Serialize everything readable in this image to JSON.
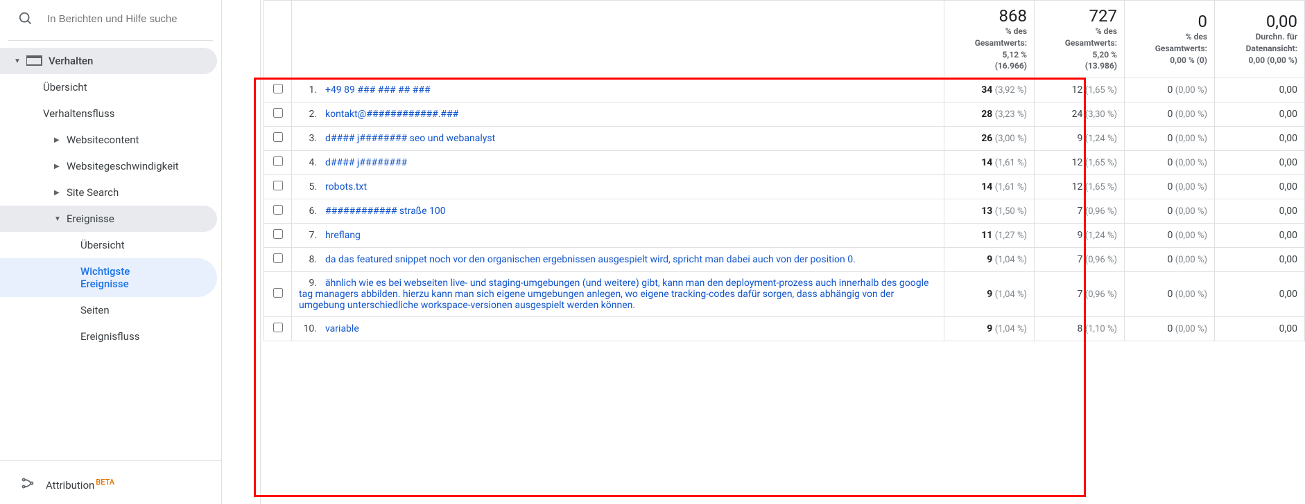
{
  "sidebar": {
    "search_placeholder": "In Berichten und Hilfe suche",
    "section": "Verhalten",
    "items": {
      "uebersicht": "Übersicht",
      "verhaltensfluss": "Verhaltensfluss",
      "websitecontent": "Websitecontent",
      "websitegeschw": "Websitegeschwindigkeit",
      "sitesearch": "Site Search",
      "ereignisse": "Ereignisse",
      "er_uebersicht": "Übersicht",
      "er_wichtigste": "Wichtigste Ereignisse",
      "er_seiten": "Seiten",
      "er_fluss": "Ereignisfluss"
    },
    "attribution": "Attribution",
    "beta": "BETA"
  },
  "table": {
    "header": {
      "col1": {
        "big": "868",
        "sub1": "% des Gesamtwerts:",
        "sub2": "5,12 %",
        "sub3": "(16.966)"
      },
      "col2": {
        "big": "727",
        "sub1": "% des Gesamtwerts:",
        "sub2": "5,20 %",
        "sub3": "(13.986)"
      },
      "col3": {
        "big": "0",
        "sub1": "% des Gesamtwerts:",
        "sub2": "0,00 % (0)"
      },
      "col4": {
        "big": "0,00",
        "sub1": "Durchn. für Datenansicht:",
        "sub2": "0,00 (0,00 %)"
      }
    },
    "rows": [
      {
        "n": "1.",
        "label": "+49 89 ### ### ## ###",
        "v1b": "34",
        "v1p": "(3,92 %)",
        "v2": "12",
        "v2p": "(1,65 %)",
        "v3": "0",
        "v3p": "(0,00 %)",
        "v4": "0,00"
      },
      {
        "n": "2.",
        "label": "kontakt@############.###",
        "v1b": "28",
        "v1p": "(3,23 %)",
        "v2": "24",
        "v2p": "(3,30 %)",
        "v3": "0",
        "v3p": "(0,00 %)",
        "v4": "0,00"
      },
      {
        "n": "3.",
        "label": "d#### j######## seo und webanalyst",
        "v1b": "26",
        "v1p": "(3,00 %)",
        "v2": "9",
        "v2p": "(1,24 %)",
        "v3": "0",
        "v3p": "(0,00 %)",
        "v4": "0,00"
      },
      {
        "n": "4.",
        "label": "d#### j########",
        "v1b": "14",
        "v1p": "(1,61 %)",
        "v2": "12",
        "v2p": "(1,65 %)",
        "v3": "0",
        "v3p": "(0,00 %)",
        "v4": "0,00"
      },
      {
        "n": "5.",
        "label": "robots.txt",
        "v1b": "14",
        "v1p": "(1,61 %)",
        "v2": "12",
        "v2p": "(1,65 %)",
        "v3": "0",
        "v3p": "(0,00 %)",
        "v4": "0,00"
      },
      {
        "n": "6.",
        "label": "############ straße 100",
        "v1b": "13",
        "v1p": "(1,50 %)",
        "v2": "7",
        "v2p": "(0,96 %)",
        "v3": "0",
        "v3p": "(0,00 %)",
        "v4": "0,00"
      },
      {
        "n": "7.",
        "label": "hreflang",
        "v1b": "11",
        "v1p": "(1,27 %)",
        "v2": "9",
        "v2p": "(1,24 %)",
        "v3": "0",
        "v3p": "(0,00 %)",
        "v4": "0,00"
      },
      {
        "n": "8.",
        "label": "da das featured snippet noch vor den organischen ergebnissen ausgespielt wird, spricht man dabei auch von der position 0.",
        "v1b": "9",
        "v1p": "(1,04 %)",
        "v2": "7",
        "v2p": "(0,96 %)",
        "v3": "0",
        "v3p": "(0,00 %)",
        "v4": "0,00"
      },
      {
        "n": "9.",
        "label": "ähnlich wie es bei webseiten live- und staging-umgebungen (und weitere) gibt, kann man den deployment-prozess auch innerhalb des google tag managers abbilden. hierzu kann man sich eigene umgebungen anlegen, wo eigene tracking-codes dafür sorgen, dass abhängig von der umgebung unterschiedliche workspace-versionen ausgespielt werden können.",
        "v1b": "9",
        "v1p": "(1,04 %)",
        "v2": "7",
        "v2p": "(0,96 %)",
        "v3": "0",
        "v3p": "(0,00 %)",
        "v4": "0,00"
      },
      {
        "n": "10.",
        "label": "variable",
        "v1b": "9",
        "v1p": "(1,04 %)",
        "v2": "8",
        "v2p": "(1,10 %)",
        "v3": "0",
        "v3p": "(0,00 %)",
        "v4": "0,00"
      }
    ]
  }
}
